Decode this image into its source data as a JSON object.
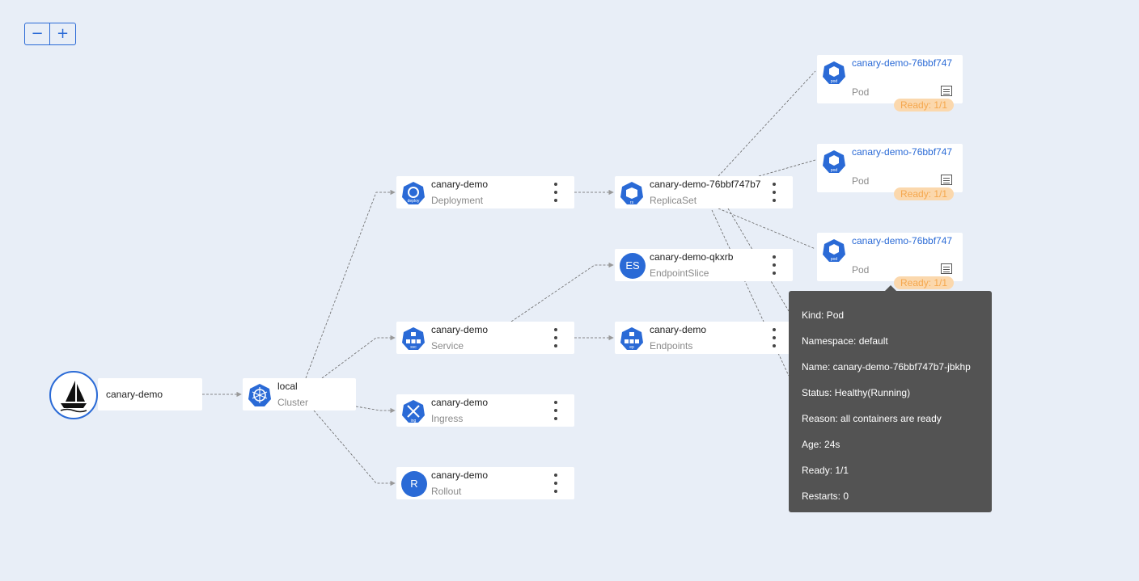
{
  "zoom": {
    "out_label": "−",
    "in_label": "+"
  },
  "app": {
    "name": "canary-demo"
  },
  "cluster": {
    "name": "local",
    "kind": "Cluster"
  },
  "nodes": {
    "deployment": {
      "name": "canary-demo",
      "kind": "Deployment",
      "icon_text": "deploy"
    },
    "service": {
      "name": "canary-demo",
      "kind": "Service",
      "icon_text": "svc"
    },
    "ingress": {
      "name": "canary-demo",
      "kind": "Ingress",
      "icon_text": "ing"
    },
    "rollout": {
      "name": "canary-demo",
      "kind": "Rollout",
      "icon_text": "R"
    },
    "replicaset": {
      "name": "canary-demo-76bbf747b7",
      "kind": "ReplicaSet",
      "icon_text": "rs"
    },
    "endpointslice": {
      "name": "canary-demo-qkxrb",
      "kind": "EndpointSlice",
      "icon_text": "ES"
    },
    "endpoints": {
      "name": "canary-demo",
      "kind": "Endpoints",
      "icon_text": "ep"
    }
  },
  "pods": [
    {
      "name": "canary-demo-76bbf747",
      "kind": "Pod",
      "ready": "Ready: 1/1",
      "icon_text": "pod"
    },
    {
      "name": "canary-demo-76bbf747",
      "kind": "Pod",
      "ready": "Ready: 1/1",
      "icon_text": "pod"
    },
    {
      "name": "canary-demo-76bbf747",
      "kind": "Pod",
      "ready": "Ready: 1/1",
      "icon_text": "pod"
    }
  ],
  "tooltip": {
    "kind": "Kind: Pod",
    "namespace": "Namespace: default",
    "name": "Name: canary-demo-76bbf747b7-jbkhp",
    "status": "Status: Healthy(Running)",
    "reason": "Reason: all containers are ready",
    "age": "Age: 24s",
    "ready": "Ready: 1/1",
    "restarts": "Restarts: 0"
  },
  "colors": {
    "accent": "#2a6ad6",
    "background": "#e8eef7",
    "ready_bg": "#fbd8ad",
    "ready_text": "#f5a74d",
    "tooltip_bg": "#535353"
  }
}
